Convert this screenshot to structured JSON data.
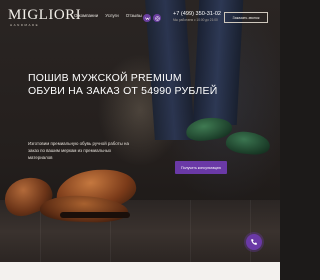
{
  "header": {
    "logo": "MIGLIORI",
    "logo_sub": "HANDMADE",
    "nav": [
      "О компании",
      "Услуги",
      "Отзывы"
    ],
    "social_icons": [
      "vk-icon",
      "instagram-icon"
    ],
    "phone": "+7 (499) 350-31-02",
    "phone_sub": "Мы работаем с 10:00 до 21:00",
    "callback_button": "Заказать звонок"
  },
  "hero": {
    "headline": [
      "ПОШИВ МУЖСКОЙ PREMIUM",
      "ОБУВИ НА ЗАКАЗ ОТ 54990 РУБЛЕЙ"
    ],
    "description": [
      "Изготовим премиальную обувь ручной работы на",
      "заказ по вашим меркам из премиальных",
      "материалов"
    ],
    "cta_button": "Получить консультацию"
  },
  "colors": {
    "accent": "#6a39a6"
  }
}
